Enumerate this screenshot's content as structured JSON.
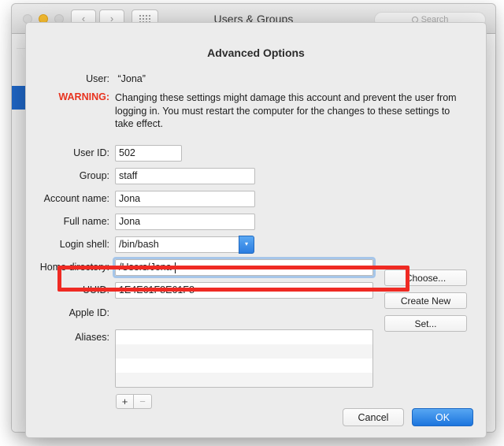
{
  "window": {
    "title": "Users & Groups",
    "traffic_lights": [
      "close-button",
      "minimize-button",
      "zoom-button"
    ],
    "nav_back_glyph": "‹",
    "nav_forward_glyph": "›",
    "search": {
      "placeholder": "Search",
      "value": "",
      "icon": "search-icon"
    }
  },
  "sheet": {
    "title": "Advanced Options",
    "user_label": "User:",
    "user_value": "“Jona”",
    "warning_label": "WARNING:",
    "warning_text": "Changing these settings might damage this account and prevent the user from logging in. You must restart the computer for the changes to these settings to take effect.",
    "warning_color": "#e8331f",
    "fields": {
      "user_id": {
        "label": "User ID:",
        "value": "502"
      },
      "group": {
        "label": "Group:",
        "value": "staff"
      },
      "account_name": {
        "label": "Account name:",
        "value": "Jona"
      },
      "full_name": {
        "label": "Full name:",
        "value": "Jona"
      },
      "login_shell": {
        "label": "Login shell:",
        "value": "/bin/bash",
        "chevron": "▾"
      },
      "home_directory": {
        "label": "Home directory:",
        "value": "/Users/Jona"
      },
      "uuid": {
        "label": "UUID:",
        "value": "1E4E61F8E61F8"
      },
      "apple_id": {
        "label": "Apple ID:",
        "value": ""
      },
      "aliases": {
        "label": "Aliases:",
        "items": []
      }
    },
    "side_buttons": {
      "choose": "Choose...",
      "create_new": "Create New",
      "set": "Set..."
    },
    "alias_buttons": {
      "add": "+",
      "remove": "−"
    },
    "footer": {
      "cancel": "Cancel",
      "ok": "OK"
    },
    "highlight_color": "#ef2a23",
    "accent_color": "#1c75de"
  }
}
